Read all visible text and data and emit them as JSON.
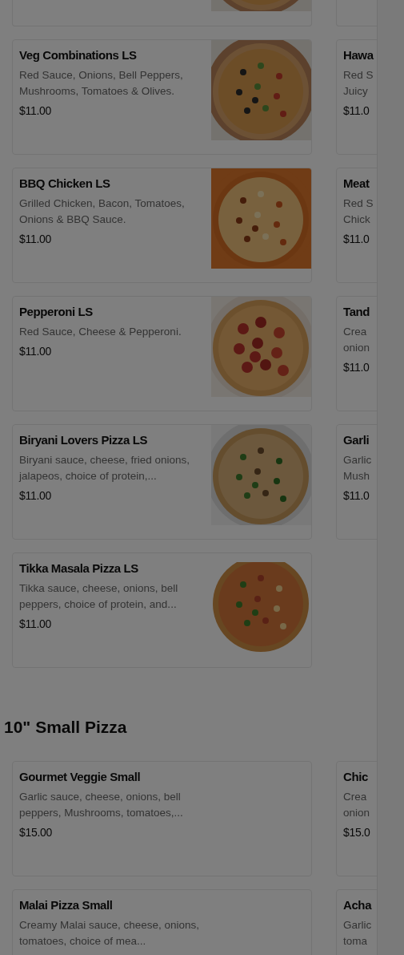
{
  "sections": [
    {
      "cards_left": [
        {
          "partial": true
        },
        {
          "title": "Veg Combinations LS",
          "description": "Red Sauce, Onions, Bell Peppers, Mushrooms, Tomatoes & Olives.",
          "price": "$11.00"
        },
        {
          "title": "BBQ Chicken LS",
          "description": "Grilled Chicken, Bacon, Tomatoes, Onions & BBQ Sauce.",
          "price": "$11.00"
        },
        {
          "title": "Pepperoni LS",
          "description": "Red Sauce, Cheese & Pepperoni.",
          "price": "$11.00"
        },
        {
          "title": "Biryani Lovers Pizza LS",
          "description": "Biryani sauce, cheese, fried onions, jalapeos, choice of protein,...",
          "price": "$11.00"
        },
        {
          "title": "Tikka Masala Pizza LS",
          "description": "Tikka sauce, cheese, onions, bell peppers, choice of protein, and...",
          "price": "$11.00"
        }
      ],
      "cards_right": [
        {
          "partial": true
        },
        {
          "title": "Hawa",
          "description": "Red S\nJuicy",
          "price": "$11.0"
        },
        {
          "title": "Meat",
          "description": "Red S\nChick",
          "price": "$11.0"
        },
        {
          "title": "Tand",
          "description": "Crea\nonion",
          "price": "$11.0"
        },
        {
          "title": "Garli",
          "description": "Garlic\nMush",
          "price": "$11.0"
        }
      ]
    },
    {
      "heading": "10\" Small Pizza",
      "cards_left": [
        {
          "title": "Gourmet Veggie Small",
          "description": "Garlic sauce, cheese, onions, bell peppers, Mushrooms, tomatoes,...",
          "price": "$15.00"
        },
        {
          "title": "Malai Pizza Small",
          "description": "Creamy Malai sauce, cheese, onions, tomatoes, choice of mea..."
        }
      ],
      "cards_right": [
        {
          "title": "Chic",
          "description": "Crea\nonion",
          "price": "$15.0"
        },
        {
          "title": "Acha",
          "description": "Garlic\ntoma"
        }
      ]
    }
  ]
}
